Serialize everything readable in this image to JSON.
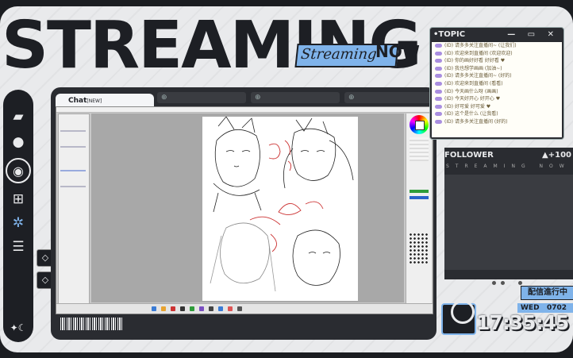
{
  "overlay": {
    "title": "STREAMING",
    "badge_script": "Streaming",
    "badge_now": "NOW"
  },
  "sidebar": {
    "items": [
      {
        "icon": "folder-icon",
        "glyph": "▰"
      },
      {
        "icon": "user-icon",
        "glyph": "●"
      },
      {
        "icon": "chat-icon",
        "glyph": "◉"
      },
      {
        "icon": "grid-icon",
        "glyph": "⊞"
      },
      {
        "icon": "gear-icon",
        "glyph": "✲"
      },
      {
        "icon": "list-icon",
        "glyph": "☰"
      }
    ],
    "bottom_glyph": "✦☾"
  },
  "side_buttons": [
    "◇",
    "◇"
  ],
  "main": {
    "chat_tab_label": "Chat",
    "chat_tab_sup": "[NEW]",
    "tabs": [
      "⊕",
      "⊕",
      "⊕"
    ]
  },
  "topic": {
    "title": "•TOPIC",
    "controls": "— ▭ ✕",
    "messages": [
      "(ID) 请多多关注直播间~ (让我们)",
      "(ID) 欢迎来到直播间 (欢迎欢迎)",
      "(ID) 你的画好好看 好好看 ♥",
      "(ID) 我也想学画画 (加油~)",
      "(ID) 请多多关注直播间~ (好的)",
      "(ID) 欢迎来到直播间 (看看)",
      "(ID) 今天画什么呀 (画画)",
      "(ID) 今天好开心 好开心 ♥",
      "(ID) 好可爱 好可爱 ♥",
      "(ID) 这个是什么 (让我看)",
      "(ID) 请多多关注直播间 (好的)"
    ]
  },
  "follower": {
    "label": "FOLLOWER",
    "count": "▲+100",
    "sub": "STREAMING NOW"
  },
  "status": {
    "live_label": "配信進行中",
    "day": "WED",
    "date": "0702",
    "time": "17:35:45"
  },
  "colors": {
    "accent": "#7fb3ea",
    "dark": "#1d1f24",
    "light": "#e9eaec"
  }
}
